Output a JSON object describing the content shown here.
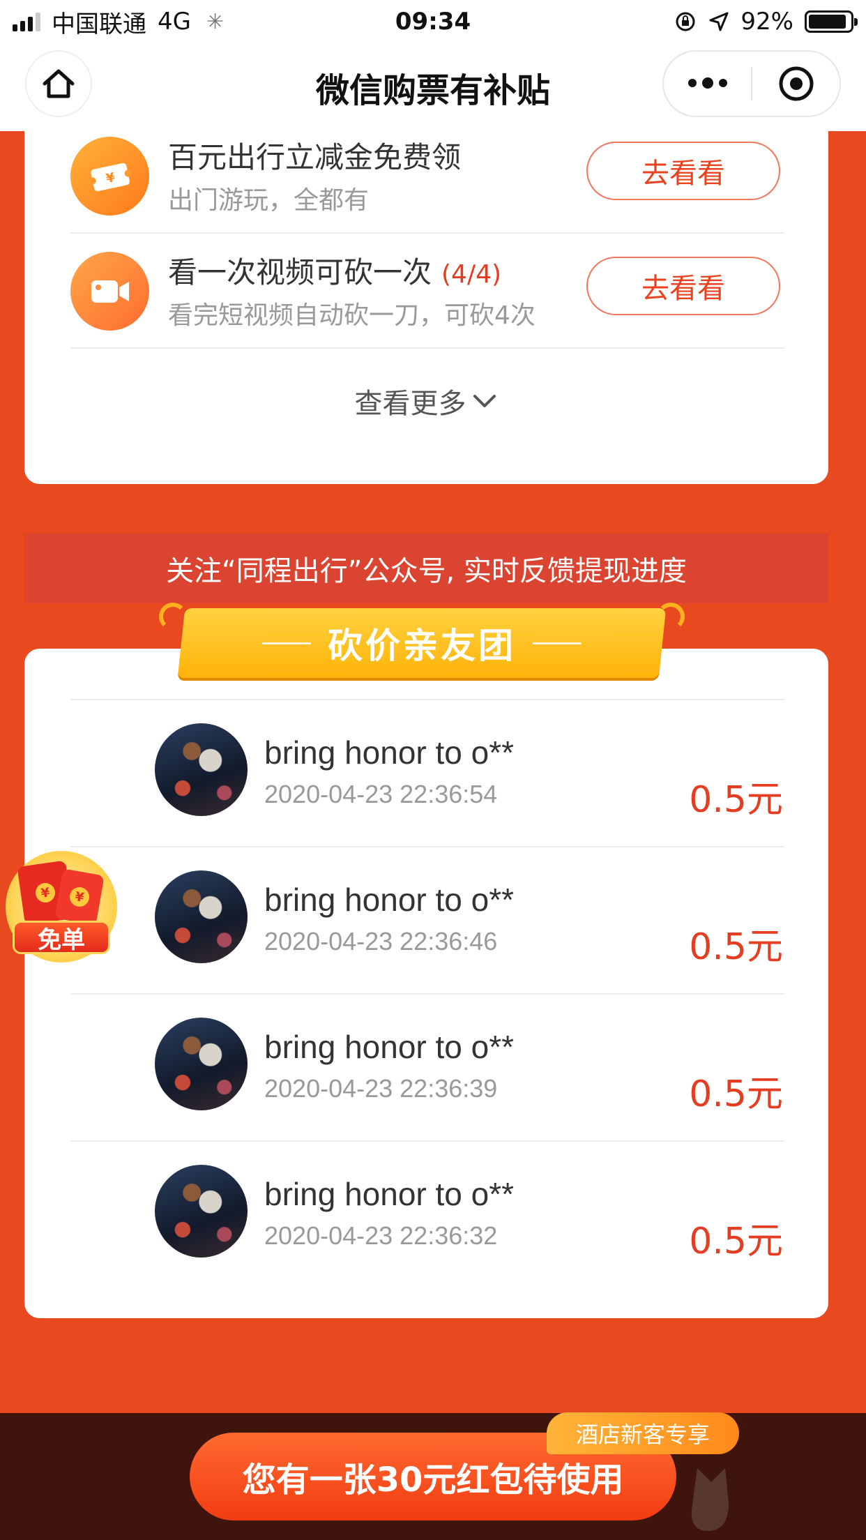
{
  "status_bar": {
    "carrier": "中国联通",
    "network": "4G",
    "time": "09:34",
    "battery": "92%",
    "battery_level": 0.92
  },
  "nav": {
    "title": "微信购票有补贴"
  },
  "tasks": [
    {
      "title": "百元出行立减金免费领",
      "count": "",
      "subtitle": "出门游玩，全都有",
      "button": "去看看",
      "icon": "ticket-icon"
    },
    {
      "title": "看一次视频可砍一次",
      "count": "(4/4)",
      "subtitle": "看完短视频自动砍一刀，可砍4次",
      "button": "去看看",
      "icon": "video-camera-icon"
    }
  ],
  "see_more": "查看更多",
  "follow_banner": "关注“同程出行”公众号, 实时反馈提现进度",
  "friends_section": {
    "title": "砍价亲友团",
    "rows": [
      {
        "name": "bring honor to o**",
        "time": "2020-04-23 22:36:54",
        "amount": "0.5元"
      },
      {
        "name": "bring honor to o**",
        "time": "2020-04-23 22:36:46",
        "amount": "0.5元"
      },
      {
        "name": "bring honor to o**",
        "time": "2020-04-23 22:36:39",
        "amount": "0.5元"
      },
      {
        "name": "bring honor to o**",
        "time": "2020-04-23 22:36:32",
        "amount": "0.5元"
      }
    ]
  },
  "free_badge": "免单",
  "bottom": {
    "cta": "您有一张30元红包待使用",
    "tag": "酒店新客专享"
  },
  "colors": {
    "brand_red": "#e8491f",
    "amount_red": "#e53d22",
    "gold": "#ffb30a"
  }
}
